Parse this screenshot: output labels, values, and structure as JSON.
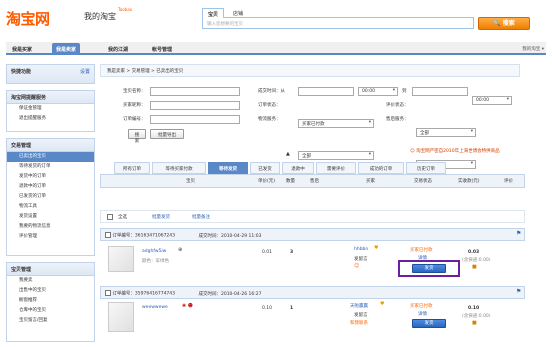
{
  "logo": {
    "brand": "淘宝网",
    "sub": "我的淘宝",
    "badge": "Taobao"
  },
  "search": {
    "tabs": [
      "宝贝",
      "店铺"
    ],
    "placeholder": "输入您想要的宝贝",
    "button": "搜索"
  },
  "nav": {
    "tabs": [
      "我是买家",
      "我是卖家",
      "我的江湖",
      "帐号管理"
    ],
    "right": "我的淘宝 ▾"
  },
  "sidebar": {
    "quick": {
      "title": "快捷功能",
      "action": "设置"
    },
    "services": {
      "title": "淘宝网提醒服务",
      "items": [
        "保证金管理",
        "退出提醒服务"
      ]
    },
    "trade": {
      "title": "交易管理",
      "items": [
        "已卖出的宝贝",
        "等待发货的订单",
        "发货中的订单",
        "退款中的订单",
        "已发货的订单",
        "物流工具",
        "发货设置",
        "我要的物流信息",
        "评价管理"
      ]
    },
    "goods": {
      "title": "宝贝管理",
      "items": [
        "我要卖",
        "出售中的宝贝",
        "橱窗推荐",
        "仓库中的宝贝",
        "宝贝留言/回复"
      ]
    }
  },
  "breadcrumb": "我是卖家 > 交易管理 > 已卖出的宝贝",
  "filters": {
    "item_name": "宝贝名称：",
    "buyer_nick": "买家昵称：",
    "order_no": "订单编号：",
    "trade_time": "成交时间：从",
    "to": "到",
    "order_status": "订单状态：",
    "order_status_val": "买家已付款",
    "logistics": "物流服务：",
    "logistics_val": "全部",
    "rating": "评价状态：",
    "rating_val": "全部",
    "aftersale": "售后服务：",
    "aftersale_val": "全部",
    "time_val": "00:00",
    "search_btn": "搜索",
    "export_btn": "批量导出"
  },
  "notice": "☺ 淘宝网严密自2010年上海世博会特供商品",
  "order_tabs": [
    "所有订单",
    "等待买家付款",
    "等待发货",
    "已发货",
    "退款中",
    "需要评价",
    "成功的订单",
    "历史订单"
  ],
  "columns": [
    "宝贝",
    "单价(元)",
    "数量",
    "售后",
    "买家",
    "交易状态",
    "实收款(元)",
    "评价"
  ],
  "batch": {
    "select_all": "全选",
    "batch_ship": "批量发货",
    "batch_memo": "批量备注"
  },
  "orders": [
    {
      "order_no": "订单编号：36163471067243",
      "time": "成交时间：2010-04-29 11:03",
      "item": "adghfw5iw",
      "item_sub": "颜色：军绿色",
      "price": "0.01",
      "qty": "3",
      "buyer": "hhbbn",
      "buyer_sub": "发留言",
      "status": "买家已付款",
      "status_detail": "详情",
      "action": "发货",
      "amount": "0.03",
      "amount_sub": "(含快递:0.00)"
    },
    {
      "order_no": "订单编号：35976416774743",
      "time": "成交时间：2010-04-26 16:27",
      "item": "weewwewe",
      "item_sub": "",
      "price": "0.10",
      "qty": "1",
      "buyer": "天啦赢赢",
      "buyer_sub": "发留言",
      "buyer_extra": "和我联系",
      "status": "买家已付款",
      "status_detail": "详情",
      "action": "发货",
      "amount": "0.10",
      "amount_sub": "(含快递:0.00)"
    }
  ],
  "colors": {
    "orange": "#ff6600",
    "blue": "#5a87c5",
    "highlight": "#6a1fa0"
  }
}
